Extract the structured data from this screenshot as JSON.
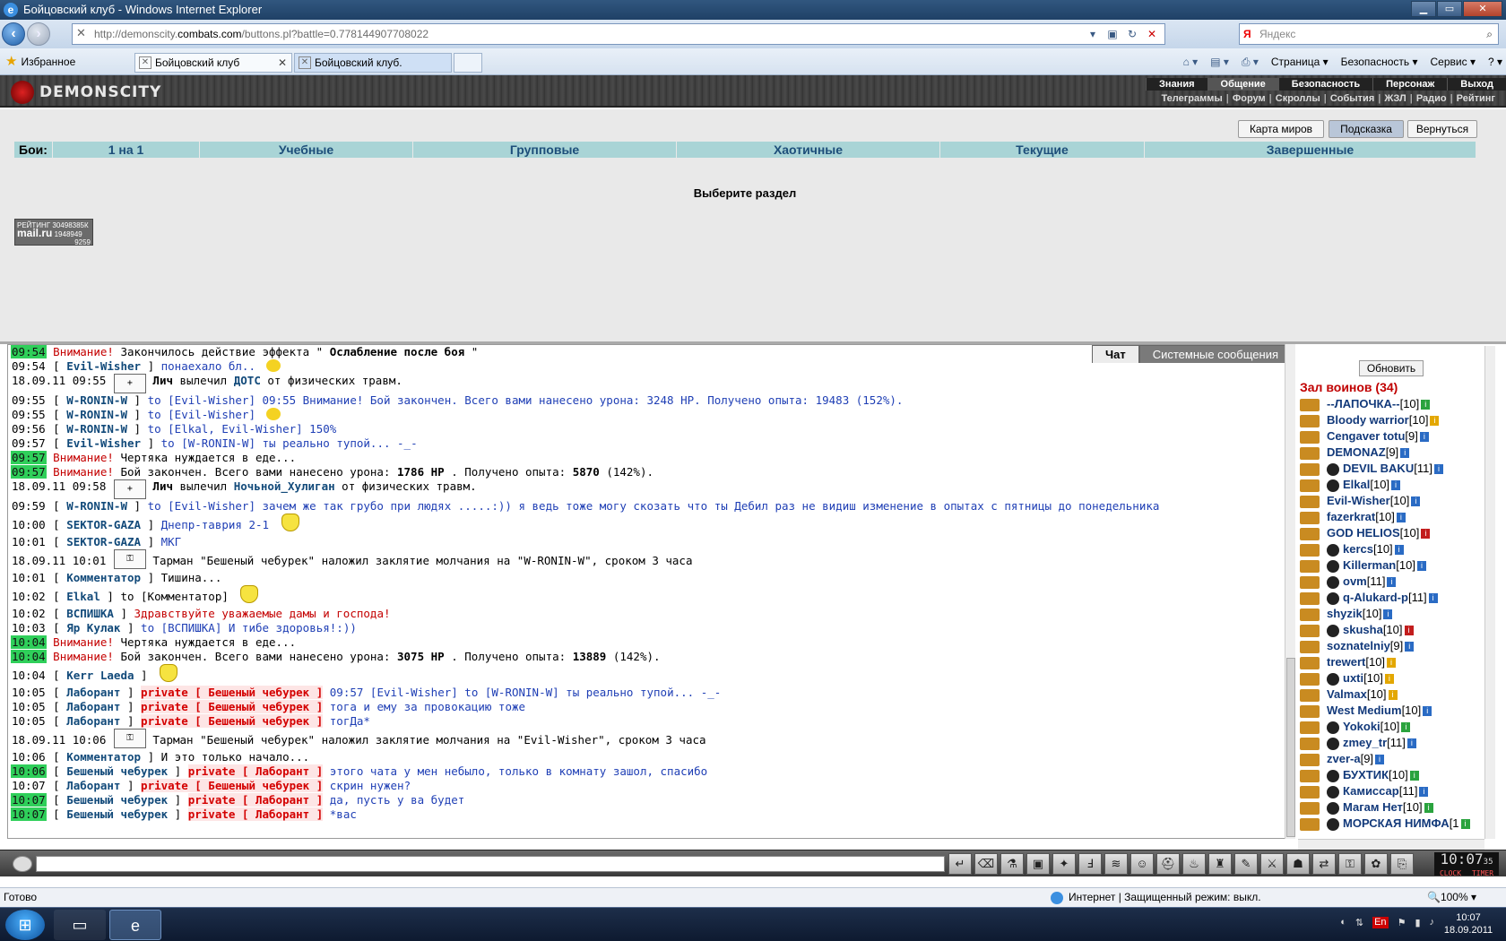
{
  "window": {
    "title": "Бойцовский клуб - Windows Internet Explorer",
    "min": "▁",
    "max": "▭",
    "close": "✕"
  },
  "address": {
    "url_prefix": "http://demonscity.",
    "url_domain": "combats.com",
    "url_rest": "/buttons.pl?battle=0.778144907708022",
    "search_placeholder": "Яндекс",
    "search_logo": "Я"
  },
  "tabs": {
    "favorites": "Избранное",
    "tab1": "Бойцовский клуб",
    "tab2": "Бойцовский клуб."
  },
  "commands": [
    "Страница ▾",
    "Безопасность ▾",
    "Сервис ▾",
    "? ▾"
  ],
  "game": {
    "logo": "DEMONSCITY",
    "nav_main": [
      "Знания",
      "Общение",
      "Безопасность",
      "Персонаж",
      "Выход"
    ],
    "nav_sub": [
      "Телеграммы",
      "Форум",
      "Скроллы",
      "События",
      "ЖЗЛ",
      "Радио",
      "Рейтинг"
    ],
    "buttons": {
      "map": "Карта миров",
      "hint": "Подсказка",
      "back": "Вернуться"
    },
    "battle_label": "Бои:",
    "battle_tabs": [
      "1 на 1",
      "Учебные",
      "Групповые",
      "Хаотичные",
      "Текущие",
      "Завершенные"
    ],
    "select_msg": "Выберите раздел",
    "rating": {
      "line1": "РЕЙТИНГ 30498385К",
      "brand": "mail.ru",
      "n1": "1948949",
      "n2": "9259"
    }
  },
  "chat": {
    "tab_chat": "Чат",
    "tab_sys": "Системные сообщения",
    "lines": [
      {
        "ts": "09:54",
        "hl": true,
        "parts": [
          [
            "warn",
            "Внимание!"
          ],
          [
            "",
            "Закончилось действие эффекта \""
          ],
          [
            "b",
            "Ослабление после боя"
          ],
          [
            "",
            "\""
          ]
        ]
      },
      {
        "ts": "09:54",
        "parts": [
          [
            "",
            "["
          ],
          [
            "nk",
            "Evil-Wisher"
          ],
          [
            "",
            "]"
          ],
          [
            "bl",
            "понаехало бл.."
          ]
        ],
        "sm": true
      },
      {
        "ts": "18.09.11 09:55",
        "ic": "+",
        "parts": [
          [
            "b",
            "Лич"
          ],
          [
            "",
            "вылечил"
          ],
          [
            "nk",
            "ДОТС"
          ],
          [
            "",
            "от физических травм."
          ]
        ]
      },
      {
        "ts": "09:55",
        "parts": [
          [
            "",
            "["
          ],
          [
            "nk",
            "W-RONIN-W"
          ],
          [
            "",
            "]"
          ],
          [
            "bl",
            "to [Evil-Wisher] 09:55 Внимание! Бой закончен. Всего вами нанесено урона: 3248 HP. Получено опыта: 19483 (152%)."
          ]
        ]
      },
      {
        "ts": "09:55",
        "parts": [
          [
            "",
            "["
          ],
          [
            "nk",
            "W-RONIN-W"
          ],
          [
            "",
            "]"
          ],
          [
            "bl",
            "to [Evil-Wisher]"
          ]
        ],
        "sm": true
      },
      {
        "ts": "09:56",
        "parts": [
          [
            "",
            "["
          ],
          [
            "nk",
            "W-RONIN-W"
          ],
          [
            "",
            "]"
          ],
          [
            "bl",
            "to [Elkal, Evil-Wisher] 150%"
          ]
        ]
      },
      {
        "ts": "09:57",
        "parts": [
          [
            "",
            "["
          ],
          [
            "nk",
            "Evil-Wisher"
          ],
          [
            "",
            "]"
          ],
          [
            "bl",
            "to [W-RONIN-W] ты реально тупой... -_-"
          ]
        ]
      },
      {
        "ts": "09:57",
        "hl": true,
        "parts": [
          [
            "warn",
            "Внимание!"
          ],
          [
            "",
            "Чертяка нуждается в еде..."
          ]
        ]
      },
      {
        "ts": "09:57",
        "hl": true,
        "parts": [
          [
            "warn",
            "Внимание!"
          ],
          [
            "",
            "Бой закончен. Всего вами нанесено урона:"
          ],
          [
            "b",
            "1786 HP"
          ],
          [
            "",
            ". Получено опыта:"
          ],
          [
            "b",
            "5870"
          ],
          [
            "",
            "(142%)."
          ]
        ]
      },
      {
        "ts": "18.09.11 09:58",
        "ic": "+",
        "parts": [
          [
            "b",
            "Лич"
          ],
          [
            "",
            "вылечил"
          ],
          [
            "nk",
            "Ночьной_Хулиган"
          ],
          [
            "",
            "от физических травм."
          ]
        ]
      },
      {
        "ts": "09:59",
        "parts": [
          [
            "",
            "["
          ],
          [
            "nk",
            "W-RONIN-W"
          ],
          [
            "",
            "]"
          ],
          [
            "bl",
            "to [Evil-Wisher] зачем же так грубо при людях .....:)) я ведь тоже могу скозать что ты Дебил раз не видиш изменение в опытах с пятницы до понедельника"
          ]
        ]
      },
      {
        "ts": "10:00",
        "tall": true,
        "parts": [
          [
            "",
            "["
          ],
          [
            "nk",
            "SEKTOR-GAZA"
          ],
          [
            "",
            "]"
          ],
          [
            "bl",
            "Днепр-таврия 2-1"
          ]
        ],
        "hn": true
      },
      {
        "ts": "10:01",
        "parts": [
          [
            "",
            "["
          ],
          [
            "nk",
            "SEKTOR-GAZA"
          ],
          [
            "",
            "]"
          ],
          [
            "bl",
            "МКГ"
          ]
        ]
      },
      {
        "ts": "18.09.11 10:01",
        "tall": true,
        "ic": "⚿",
        "parts": [
          [
            "",
            "Тарман \"Бешеный чебурек\" наложил заклятие молчания на \"W-RONIN-W\", сроком 3 часа"
          ]
        ]
      },
      {
        "ts": "10:01",
        "parts": [
          [
            "",
            "["
          ],
          [
            "nk",
            "Комментатор"
          ],
          [
            "",
            "] Тишина..."
          ]
        ]
      },
      {
        "ts": "10:02",
        "tall": true,
        "parts": [
          [
            "",
            "["
          ],
          [
            "nk",
            "Elkal"
          ],
          [
            "",
            "] to [Комментатор]"
          ]
        ],
        "hn": true
      },
      {
        "ts": "10:02",
        "parts": [
          [
            "",
            "["
          ],
          [
            "nk",
            "ВСПИШКА"
          ],
          [
            "",
            "]"
          ],
          [
            "warn",
            "Здравствуйте уважаемые дамы и господа!"
          ]
        ]
      },
      {
        "ts": "10:03",
        "parts": [
          [
            "",
            "["
          ],
          [
            "nk",
            "Яр Кулак"
          ],
          [
            "",
            "]"
          ],
          [
            "bl",
            "to [ВСПИШКА] И тибе здоровья!:))"
          ]
        ]
      },
      {
        "ts": "10:04",
        "hl": true,
        "parts": [
          [
            "warn",
            "Внимание!"
          ],
          [
            "",
            "Чертяка нуждается в еде..."
          ]
        ]
      },
      {
        "ts": "10:04",
        "hl": true,
        "parts": [
          [
            "warn",
            "Внимание!"
          ],
          [
            "",
            "Бой закончен. Всего вами нанесено урона:"
          ],
          [
            "b",
            "3075 HP"
          ],
          [
            "",
            ". Получено опыта:"
          ],
          [
            "b",
            "13889"
          ],
          [
            "",
            "(142%)."
          ]
        ]
      },
      {
        "ts": "10:04",
        "tall": true,
        "parts": [
          [
            "",
            "["
          ],
          [
            "nk",
            "Kerr Laeda"
          ],
          [
            "",
            "]"
          ]
        ],
        "hn": true
      },
      {
        "ts": "10:05",
        "parts": [
          [
            "",
            "["
          ],
          [
            "nk",
            "Лаборант"
          ],
          [
            "",
            "]"
          ],
          [
            "pv",
            "private [ Бешеный чебурек ]"
          ],
          [
            "bl",
            "09:57 [Evil-Wisher] to [W-RONIN-W] ты реально тупой... -_-"
          ]
        ]
      },
      {
        "ts": "10:05",
        "parts": [
          [
            "",
            "["
          ],
          [
            "nk",
            "Лаборант"
          ],
          [
            "",
            "]"
          ],
          [
            "pv",
            "private [ Бешеный чебурек ]"
          ],
          [
            "bl",
            "тога и ему за провокацию тоже"
          ]
        ]
      },
      {
        "ts": "10:05",
        "parts": [
          [
            "",
            "["
          ],
          [
            "nk",
            "Лаборант"
          ],
          [
            "",
            "]"
          ],
          [
            "pv",
            "private [ Бешеный чебурек ]"
          ],
          [
            "bl",
            "тогДа*"
          ]
        ]
      },
      {
        "ts": "18.09.11 10:06",
        "tall": true,
        "ic": "⚿",
        "parts": [
          [
            "",
            "Тарман \"Бешеный чебурек\" наложил заклятие молчания на \"Evil-Wisher\", сроком 3 часа"
          ]
        ]
      },
      {
        "ts": "10:06",
        "parts": [
          [
            "",
            "["
          ],
          [
            "nk",
            "Комментатор"
          ],
          [
            "",
            "] И это только начало..."
          ]
        ]
      },
      {
        "ts": "10:06",
        "hl": true,
        "parts": [
          [
            "",
            "["
          ],
          [
            "nk",
            "Бешеный чебурек"
          ],
          [
            "",
            "]"
          ],
          [
            "pv",
            "private [ Лаборант ]"
          ],
          [
            "bl",
            "этого чата у мен небыло, только в комнату зашол, спасибо"
          ]
        ]
      },
      {
        "ts": "10:07",
        "parts": [
          [
            "",
            "["
          ],
          [
            "nk",
            "Лаборант"
          ],
          [
            "",
            "]"
          ],
          [
            "pv",
            "private [ Бешеный чебурек ]"
          ],
          [
            "bl",
            "скрин нужен?"
          ]
        ]
      },
      {
        "ts": "10:07",
        "hl": true,
        "parts": [
          [
            "",
            "["
          ],
          [
            "nk",
            "Бешеный чебурек"
          ],
          [
            "",
            "]"
          ],
          [
            "pv",
            "private [ Лаборант ]"
          ],
          [
            "bl",
            "да, пусть у ва будет"
          ]
        ]
      },
      {
        "ts": "10:07",
        "hl": true,
        "parts": [
          [
            "",
            "["
          ],
          [
            "nk",
            "Бешеный чебурек"
          ],
          [
            "",
            "]"
          ],
          [
            "pv",
            "private [ Лаборант ]"
          ],
          [
            "bl",
            "*вас"
          ]
        ]
      }
    ]
  },
  "hall": {
    "refresh": "Обновить",
    "title": "Зал воинов (34)",
    "players": [
      {
        "name": "--ЛАПОЧКА--",
        "lvl": "[10]",
        "inf": ""
      },
      {
        "name": "Bloody warrior",
        "lvl": "[10]",
        "inf": "y"
      },
      {
        "name": "Cengaver totu",
        "lvl": "[9]",
        "inf": "b"
      },
      {
        "name": "DEMONAZ",
        "lvl": "[9]",
        "inf": "b"
      },
      {
        "name": "DEVIL BAKU",
        "lvl": "[11]",
        "inf": "b",
        "g": true
      },
      {
        "name": "Elkal",
        "lvl": "[10]",
        "inf": "b",
        "g": true
      },
      {
        "name": "Evil-Wisher",
        "lvl": "[10]",
        "inf": "b"
      },
      {
        "name": "fazerkrat",
        "lvl": "[10]",
        "inf": "b"
      },
      {
        "name": "GOD HELIOS",
        "lvl": "[10]",
        "inf": "r"
      },
      {
        "name": "kercs",
        "lvl": "[10]",
        "inf": "b",
        "g": true
      },
      {
        "name": "Killerman",
        "lvl": "[10]",
        "inf": "b",
        "g": true
      },
      {
        "name": "ovm",
        "lvl": "[11]",
        "inf": "b",
        "g": true
      },
      {
        "name": "q-Alukard-p",
        "lvl": "[11]",
        "inf": "b",
        "g": true
      },
      {
        "name": "shyzik",
        "lvl": "[10]",
        "inf": "b"
      },
      {
        "name": "skusha",
        "lvl": "[10]",
        "inf": "r",
        "g": true
      },
      {
        "name": "soznatelniy",
        "lvl": "[9]",
        "inf": "b"
      },
      {
        "name": "trewert",
        "lvl": "[10]",
        "inf": "y"
      },
      {
        "name": "uxti",
        "lvl": "[10]",
        "inf": "y",
        "g": true
      },
      {
        "name": "Valmax",
        "lvl": "[10]",
        "inf": "y"
      },
      {
        "name": "West Medium",
        "lvl": "[10]",
        "inf": "b"
      },
      {
        "name": "Yokoki",
        "lvl": "[10]",
        "inf": "",
        "g": true
      },
      {
        "name": "zmey_tr",
        "lvl": "[11]",
        "inf": "b",
        "g": true
      },
      {
        "name": "zver-a",
        "lvl": "[9]",
        "inf": "b"
      },
      {
        "name": "БУХТИК",
        "lvl": "[10]",
        "inf": "",
        "g": true
      },
      {
        "name": "Камиссар",
        "lvl": "[11]",
        "inf": "b",
        "g": true
      },
      {
        "name": "Магам Нет",
        "lvl": "[10]",
        "inf": "",
        "g": true
      },
      {
        "name": "МОРСКАЯ НИМФА",
        "lvl": "[1",
        "inf": "",
        "g": true
      }
    ]
  },
  "clock": {
    "time": "10:07",
    "sec": "35",
    "l1": "CLOCK",
    "l2": "TIMER"
  },
  "status": {
    "ready": "Готово",
    "zone": "Интернет | Защищенный режим: выкл.",
    "zoom": "🔍100% ▾"
  },
  "taskbar": {
    "lang": "En",
    "time": "10:07",
    "date": "18.09.2011"
  }
}
